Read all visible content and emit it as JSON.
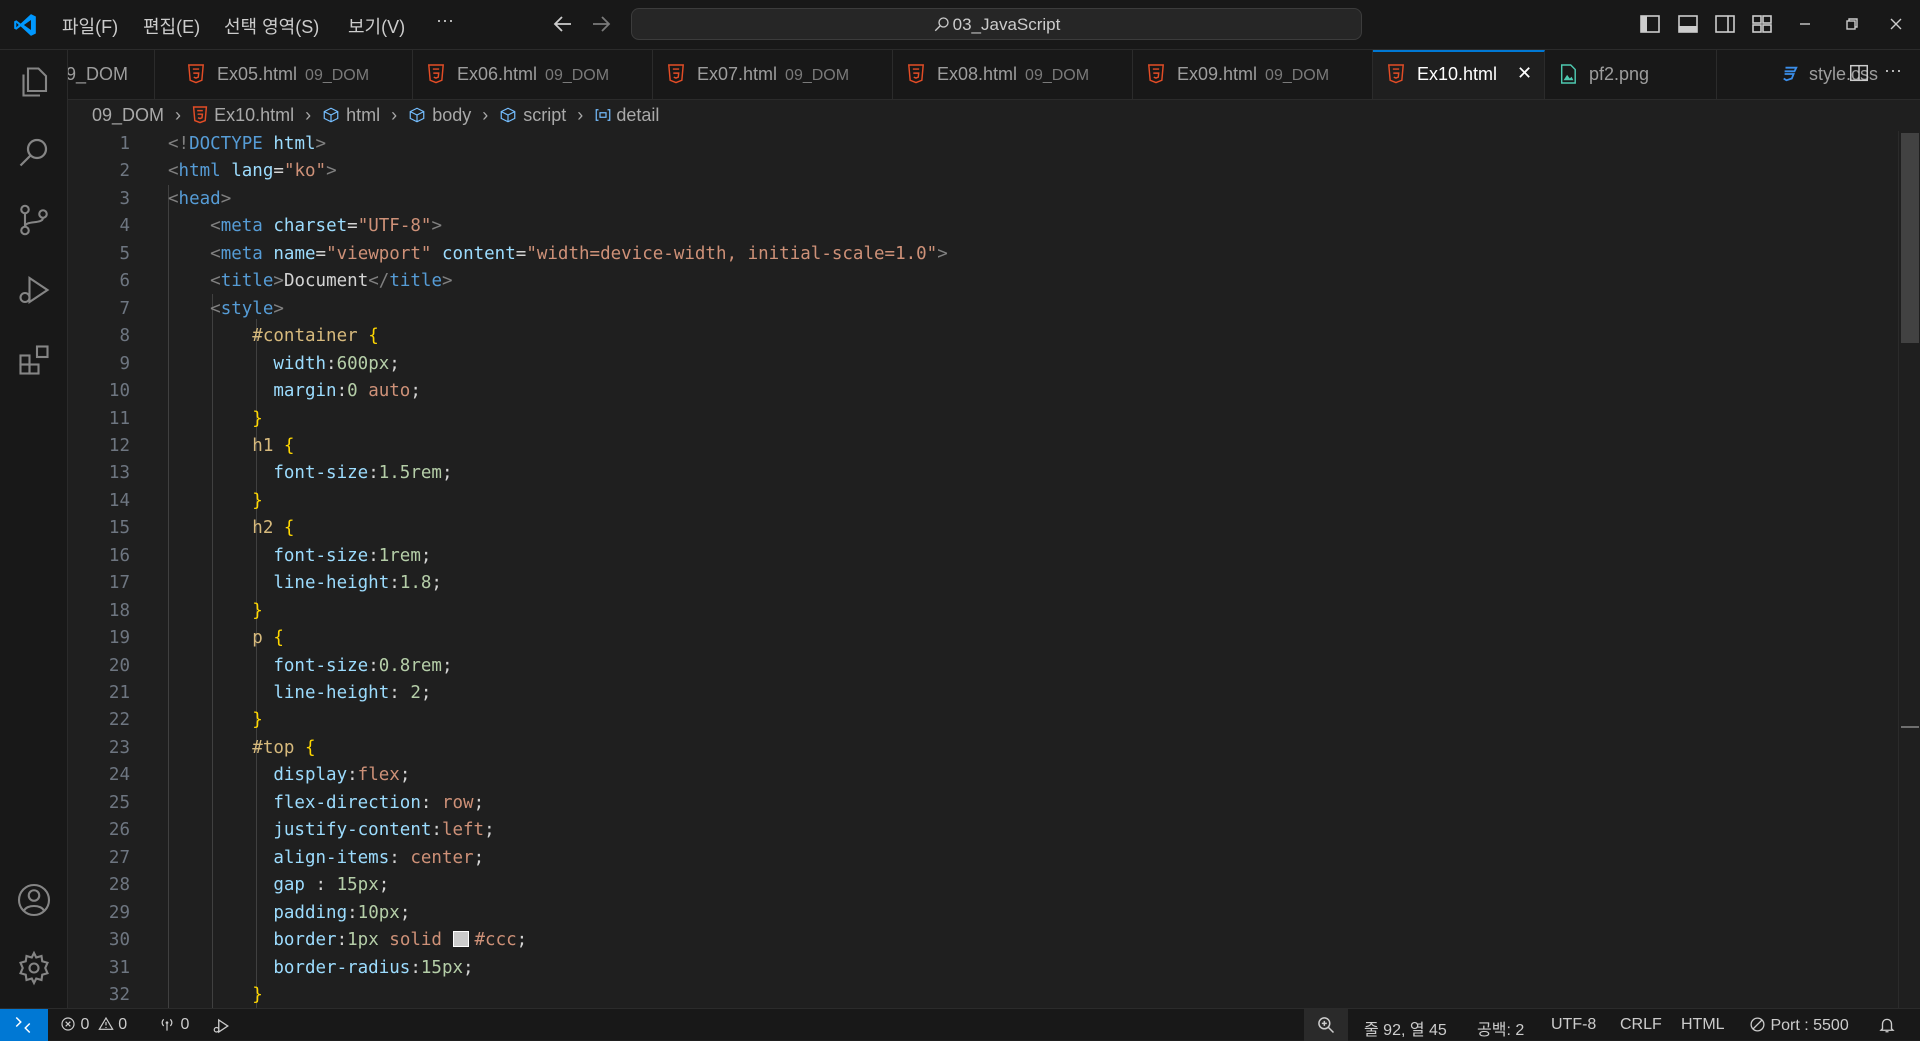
{
  "menu": {
    "file": "파일(F)",
    "edit": "편집(E)",
    "selection": "선택 영역(S)",
    "view": "보기(V)",
    "more": "···"
  },
  "command_center": {
    "text": "03_JavaScript"
  },
  "tabs": [
    {
      "name": "9_DOM",
      "dir": ""
    },
    {
      "name": "Ex05.html",
      "dir": "09_DOM"
    },
    {
      "name": "Ex06.html",
      "dir": "09_DOM"
    },
    {
      "name": "Ex07.html",
      "dir": "09_DOM"
    },
    {
      "name": "Ex08.html",
      "dir": "09_DOM"
    },
    {
      "name": "Ex09.html",
      "dir": "09_DOM"
    },
    {
      "name": "Ex10.html",
      "dir": ""
    },
    {
      "name": "pf2.png",
      "dir": ""
    },
    {
      "name": "style.css",
      "dir": ""
    }
  ],
  "tab_close": "✕",
  "breadcrumb": {
    "folder": "09_DOM",
    "file": "Ex10.html",
    "html": "html",
    "body": "body",
    "script": "script",
    "detail": "detail"
  },
  "code": [
    {
      "n": "1"
    },
    {
      "n": "2"
    },
    {
      "n": "3"
    },
    {
      "n": "4"
    },
    {
      "n": "5"
    },
    {
      "n": "6"
    },
    {
      "n": "7"
    },
    {
      "n": "8"
    },
    {
      "n": "9"
    },
    {
      "n": "10"
    },
    {
      "n": "11"
    },
    {
      "n": "12"
    },
    {
      "n": "13"
    },
    {
      "n": "14"
    },
    {
      "n": "15"
    },
    {
      "n": "16"
    },
    {
      "n": "17"
    },
    {
      "n": "18"
    },
    {
      "n": "19"
    },
    {
      "n": "20"
    },
    {
      "n": "21"
    },
    {
      "n": "22"
    },
    {
      "n": "23"
    },
    {
      "n": "24"
    },
    {
      "n": "25"
    },
    {
      "n": "26"
    },
    {
      "n": "27"
    },
    {
      "n": "28"
    },
    {
      "n": "29"
    },
    {
      "n": "30"
    },
    {
      "n": "31"
    },
    {
      "n": "32"
    }
  ],
  "code_text": [
    [
      [
        "t-punc",
        "<!"
      ],
      [
        "t-tag",
        "DOCTYPE "
      ],
      [
        "t-attr",
        "html"
      ],
      [
        "t-punc",
        ">"
      ]
    ],
    [
      [
        "t-punc",
        "<"
      ],
      [
        "t-tag",
        "html "
      ],
      [
        "t-attr",
        "lang"
      ],
      [
        "t-text",
        "="
      ],
      [
        "t-str",
        "\"ko\""
      ],
      [
        "t-punc",
        ">"
      ]
    ],
    [
      [
        "t-punc",
        "<"
      ],
      [
        "t-tag",
        "head"
      ],
      [
        "t-punc",
        ">"
      ]
    ],
    [
      [
        "t-text",
        "    "
      ],
      [
        "t-punc",
        "<"
      ],
      [
        "t-tag",
        "meta "
      ],
      [
        "t-attr",
        "charset"
      ],
      [
        "t-text",
        "="
      ],
      [
        "t-str",
        "\"UTF-8\""
      ],
      [
        "t-punc",
        ">"
      ]
    ],
    [
      [
        "t-text",
        "    "
      ],
      [
        "t-punc",
        "<"
      ],
      [
        "t-tag",
        "meta "
      ],
      [
        "t-attr",
        "name"
      ],
      [
        "t-text",
        "="
      ],
      [
        "t-str",
        "\"viewport\""
      ],
      [
        "t-text",
        " "
      ],
      [
        "t-attr",
        "content"
      ],
      [
        "t-text",
        "="
      ],
      [
        "t-str",
        "\"width=device-width, initial-scale=1.0\""
      ],
      [
        "t-punc",
        ">"
      ]
    ],
    [
      [
        "t-text",
        "    "
      ],
      [
        "t-punc",
        "<"
      ],
      [
        "t-tag",
        "title"
      ],
      [
        "t-punc",
        ">"
      ],
      [
        "t-text",
        "Document"
      ],
      [
        "t-punc",
        "</"
      ],
      [
        "t-tag",
        "title"
      ],
      [
        "t-punc",
        ">"
      ]
    ],
    [
      [
        "t-text",
        "    "
      ],
      [
        "t-punc",
        "<"
      ],
      [
        "t-tag",
        "style"
      ],
      [
        "t-punc",
        ">"
      ]
    ],
    [
      [
        "t-text",
        "        "
      ],
      [
        "t-sel",
        "#container "
      ],
      [
        "t-brace",
        "{"
      ]
    ],
    [
      [
        "t-text",
        "          "
      ],
      [
        "t-prop",
        "width"
      ],
      [
        "t-text",
        ":"
      ],
      [
        "t-num",
        "600px"
      ],
      [
        "t-text",
        ";"
      ]
    ],
    [
      [
        "t-text",
        "          "
      ],
      [
        "t-prop",
        "margin"
      ],
      [
        "t-text",
        ":"
      ],
      [
        "t-num",
        "0 "
      ],
      [
        "t-val",
        "auto"
      ],
      [
        "t-text",
        ";"
      ]
    ],
    [
      [
        "t-text",
        "        "
      ],
      [
        "t-brace",
        "}"
      ]
    ],
    [
      [
        "t-text",
        "        "
      ],
      [
        "t-sel",
        "h1 "
      ],
      [
        "t-brace",
        "{"
      ]
    ],
    [
      [
        "t-text",
        "          "
      ],
      [
        "t-prop",
        "font-size"
      ],
      [
        "t-text",
        ":"
      ],
      [
        "t-num",
        "1.5rem"
      ],
      [
        "t-text",
        ";"
      ]
    ],
    [
      [
        "t-text",
        "        "
      ],
      [
        "t-brace",
        "}"
      ]
    ],
    [
      [
        "t-text",
        "        "
      ],
      [
        "t-sel",
        "h2 "
      ],
      [
        "t-brace",
        "{"
      ]
    ],
    [
      [
        "t-text",
        "          "
      ],
      [
        "t-prop",
        "font-size"
      ],
      [
        "t-text",
        ":"
      ],
      [
        "t-num",
        "1rem"
      ],
      [
        "t-text",
        ";"
      ]
    ],
    [
      [
        "t-text",
        "          "
      ],
      [
        "t-prop",
        "line-height"
      ],
      [
        "t-text",
        ":"
      ],
      [
        "t-num",
        "1.8"
      ],
      [
        "t-text",
        ";"
      ]
    ],
    [
      [
        "t-text",
        "        "
      ],
      [
        "t-brace",
        "}"
      ]
    ],
    [
      [
        "t-text",
        "        "
      ],
      [
        "t-sel",
        "p "
      ],
      [
        "t-brace",
        "{"
      ]
    ],
    [
      [
        "t-text",
        "          "
      ],
      [
        "t-prop",
        "font-size"
      ],
      [
        "t-text",
        ":"
      ],
      [
        "t-num",
        "0.8rem"
      ],
      [
        "t-text",
        ";"
      ]
    ],
    [
      [
        "t-text",
        "          "
      ],
      [
        "t-prop",
        "line-height"
      ],
      [
        "t-text",
        ": "
      ],
      [
        "t-num",
        "2"
      ],
      [
        "t-text",
        ";"
      ]
    ],
    [
      [
        "t-text",
        "        "
      ],
      [
        "t-brace",
        "}"
      ]
    ],
    [
      [
        "t-text",
        "        "
      ],
      [
        "t-sel",
        "#top "
      ],
      [
        "t-brace",
        "{"
      ]
    ],
    [
      [
        "t-text",
        "          "
      ],
      [
        "t-prop",
        "display"
      ],
      [
        "t-text",
        ":"
      ],
      [
        "t-val",
        "flex"
      ],
      [
        "t-text",
        ";"
      ]
    ],
    [
      [
        "t-text",
        "          "
      ],
      [
        "t-prop",
        "flex-direction"
      ],
      [
        "t-text",
        ": "
      ],
      [
        "t-val",
        "row"
      ],
      [
        "t-text",
        ";"
      ]
    ],
    [
      [
        "t-text",
        "          "
      ],
      [
        "t-prop",
        "justify-content"
      ],
      [
        "t-text",
        ":"
      ],
      [
        "t-val",
        "left"
      ],
      [
        "t-text",
        ";"
      ]
    ],
    [
      [
        "t-text",
        "          "
      ],
      [
        "t-prop",
        "align-items"
      ],
      [
        "t-text",
        ": "
      ],
      [
        "t-val",
        "center"
      ],
      [
        "t-text",
        ";"
      ]
    ],
    [
      [
        "t-text",
        "          "
      ],
      [
        "t-prop",
        "gap "
      ],
      [
        "t-text",
        ": "
      ],
      [
        "t-num",
        "15px"
      ],
      [
        "t-text",
        ";"
      ]
    ],
    [
      [
        "t-text",
        "          "
      ],
      [
        "t-prop",
        "padding"
      ],
      [
        "t-text",
        ":"
      ],
      [
        "t-num",
        "10px"
      ],
      [
        "t-text",
        ";"
      ]
    ],
    [
      [
        "t-text",
        "          "
      ],
      [
        "t-prop",
        "border"
      ],
      [
        "t-text",
        ":"
      ],
      [
        "t-num",
        "1px "
      ],
      [
        "t-val",
        "solid "
      ],
      [
        "swatch",
        ""
      ],
      [
        "t-val",
        "#ccc"
      ],
      [
        "t-text",
        ";"
      ]
    ],
    [
      [
        "t-text",
        "          "
      ],
      [
        "t-prop",
        "border-radius"
      ],
      [
        "t-text",
        ":"
      ],
      [
        "t-num",
        "15px"
      ],
      [
        "t-text",
        ";"
      ]
    ],
    [
      [
        "t-text",
        "        "
      ],
      [
        "t-brace",
        "}"
      ]
    ]
  ],
  "status": {
    "errors": "0",
    "warnings": "0",
    "ports": "0",
    "position": "줄 92, 열 45",
    "spaces": "공백: 2",
    "encoding": "UTF-8",
    "eol": "CRLF",
    "language": "HTML",
    "port": "Port : 5500"
  },
  "colors": {
    "accent": "#0078d4",
    "html_icon": "#e44d26",
    "css_icon": "#3b8eea",
    "png_icon": "#4ec9b0"
  }
}
